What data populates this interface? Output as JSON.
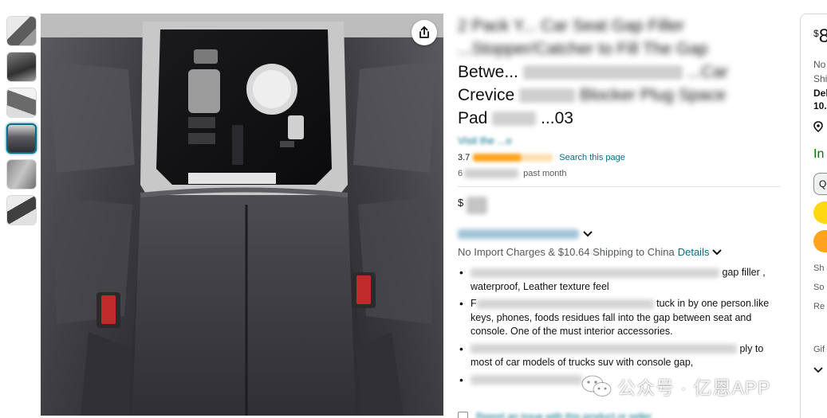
{
  "product": {
    "title_line1": "2 Pack Y... Car Seat Gap Filler",
    "title_line2": "...Stopper/Catcher to Fill The Gap",
    "title_line3": "Betwe...",
    "title_line3_end": "...Car",
    "title_line4": "Crevice",
    "title_line4_mid": "Blocker Plug Space",
    "title_line5": "Pad",
    "title_line5_end": "...03",
    "brand": "Visit the ...o",
    "rating": "3.7",
    "search_link": "Search this page",
    "bought_prefix": "6",
    "bought_suffix": "past month",
    "price_symbol": "$",
    "import_text": "No Import Charges & $10.64 Shipping to China",
    "details_link": "Details",
    "bullets": [
      {
        "end": "gap filler ,",
        "line2": "waterproof, Leather texture feel"
      },
      {
        "start": "F",
        "end": "tuck in by one person.like",
        "line2": "keys, phones, foods residues fall into the gap between seat and",
        "line3": "console. One of the must interior accessories."
      },
      {
        "end": "ply to",
        "line2": "most of car models of trucks suv with console gap,"
      },
      {
        "start": ""
      }
    ],
    "report_text": "Report an issue with this product or seller"
  },
  "buybox": {
    "price_symbol": "$",
    "price_digit": "8",
    "line_no": "No",
    "line_shi": "Shi",
    "line_del": "Del",
    "line_date": "10.",
    "stock": "In",
    "qty": "Q",
    "ships": "Sh",
    "sold": "So",
    "returns": "Re",
    "gift": "Gif"
  },
  "watermark": {
    "text": "公众号 · 亿恩APP"
  },
  "colors": {
    "link": "#007185",
    "cart_button": "#ffd814",
    "buy_button": "#ffa41c",
    "in_stock": "#007600",
    "star": "#ffa41c"
  },
  "icons": [
    "share-icon",
    "chevron-down-icon",
    "location-pin-icon",
    "wechat-icon"
  ]
}
